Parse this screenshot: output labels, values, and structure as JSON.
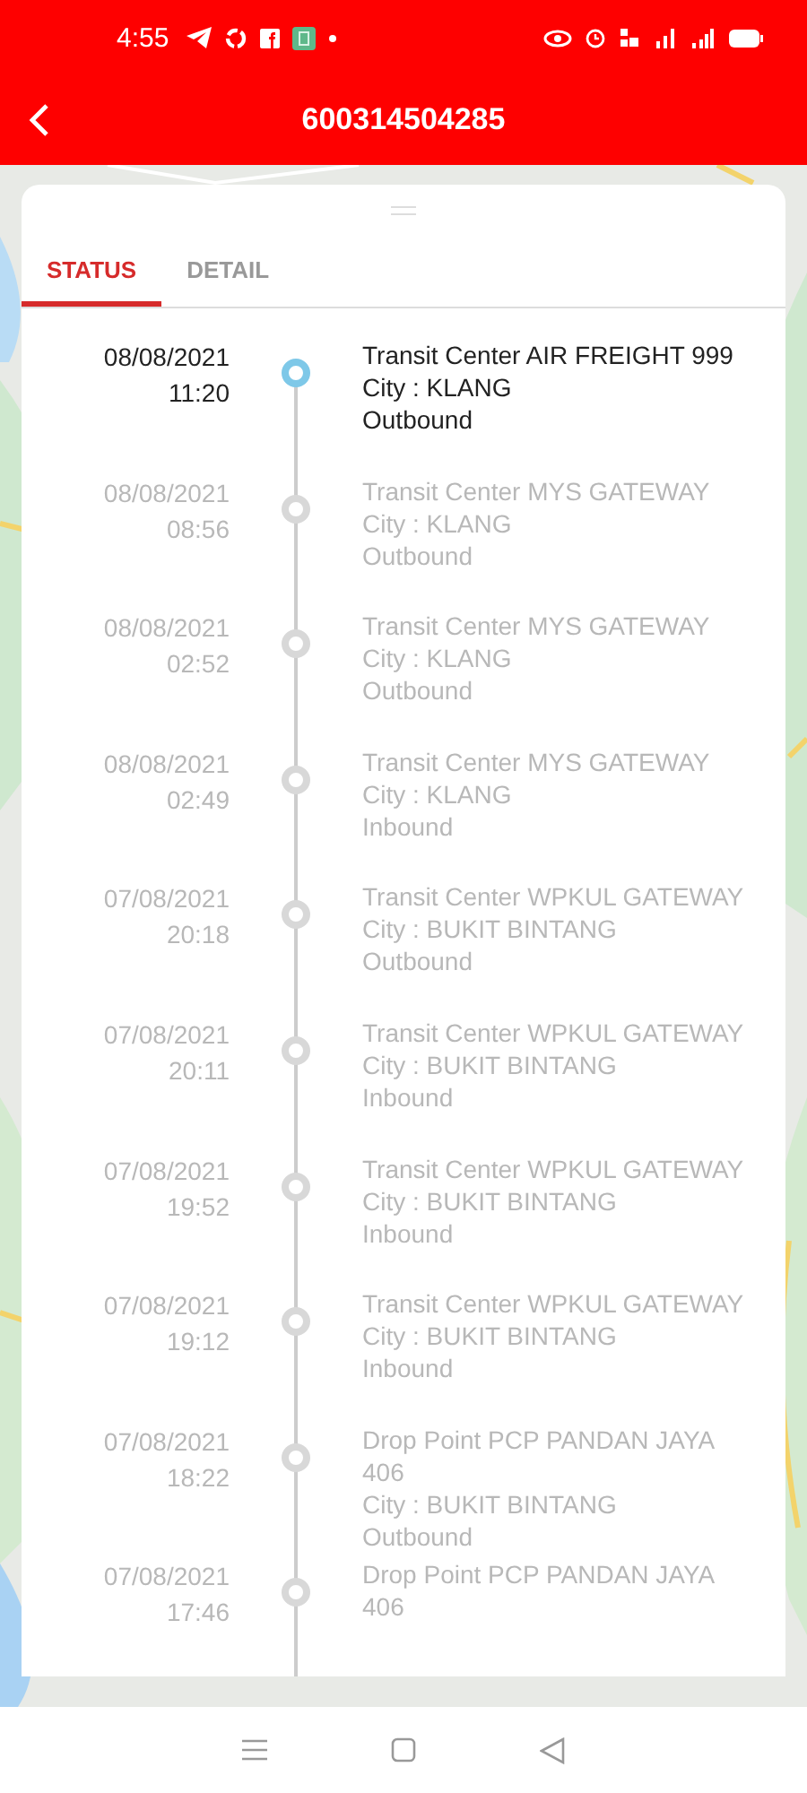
{
  "status_bar": {
    "time": "4:55"
  },
  "app_bar": {
    "title": "600314504285"
  },
  "tabs": [
    {
      "label": "STATUS",
      "selected": true
    },
    {
      "label": "DETAIL",
      "selected": false
    }
  ],
  "events": [
    {
      "date": "08/08/2021",
      "time": "11:20",
      "lines": [
        "Transit Center AIR FREIGHT 999",
        "City : KLANG",
        "Outbound"
      ],
      "current": true
    },
    {
      "date": "08/08/2021",
      "time": "08:56",
      "lines": [
        "Transit Center MYS GATEWAY",
        "City : KLANG",
        "Outbound"
      ],
      "current": false
    },
    {
      "date": "08/08/2021",
      "time": "02:52",
      "lines": [
        "Transit Center MYS GATEWAY",
        "City : KLANG",
        "Outbound"
      ],
      "current": false
    },
    {
      "date": "08/08/2021",
      "time": "02:49",
      "lines": [
        "Transit Center MYS GATEWAY",
        "City : KLANG",
        "Inbound"
      ],
      "current": false
    },
    {
      "date": "07/08/2021",
      "time": "20:18",
      "lines": [
        "Transit Center WPKUL GATEWAY",
        "City : BUKIT BINTANG",
        "Outbound"
      ],
      "current": false
    },
    {
      "date": "07/08/2021",
      "time": "20:11",
      "lines": [
        "Transit Center WPKUL GATEWAY",
        "City : BUKIT BINTANG",
        "Inbound"
      ],
      "current": false
    },
    {
      "date": "07/08/2021",
      "time": "19:52",
      "lines": [
        "Transit Center WPKUL GATEWAY",
        "City : BUKIT BINTANG",
        "Inbound"
      ],
      "current": false
    },
    {
      "date": "07/08/2021",
      "time": "19:12",
      "lines": [
        "Transit Center WPKUL GATEWAY",
        "City : BUKIT BINTANG",
        "Inbound"
      ],
      "current": false
    },
    {
      "date": "07/08/2021",
      "time": "18:22",
      "lines": [
        "Drop Point PCP PANDAN JAYA 406",
        "City : BUKIT BINTANG",
        "Outbound"
      ],
      "current": false
    },
    {
      "date": "07/08/2021",
      "time": "17:46",
      "lines": [
        "Drop Point PCP PANDAN JAYA 406"
      ],
      "current": false
    }
  ]
}
